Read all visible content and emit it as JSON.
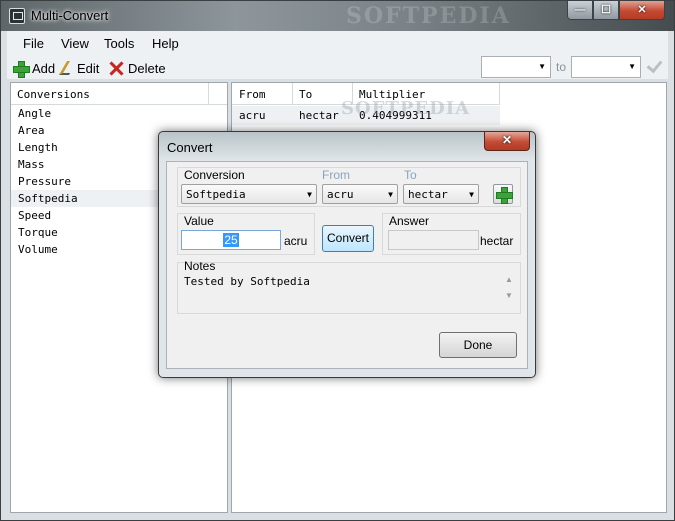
{
  "window": {
    "title": "Multi-Convert",
    "watermark": "SOFTPEDIA",
    "minimize": "—",
    "maximize": "☐",
    "close": "✕"
  },
  "menu": {
    "file": "File",
    "view": "View",
    "tools": "Tools",
    "help": "Help"
  },
  "toolbar": {
    "add_label": "Add",
    "edit_label": "Edit",
    "delete_label": "Delete",
    "to_label": "to",
    "from_value": "",
    "to_value": ""
  },
  "conversions": {
    "header": "Conversions",
    "items": [
      "Angle",
      "Area",
      "Length",
      "Mass",
      "Pressure",
      "Softpedia",
      "Speed",
      "Torque",
      "Volume"
    ],
    "selected": "Softpedia"
  },
  "table": {
    "columns": [
      "From",
      "To",
      "Multiplier"
    ],
    "rows": [
      [
        "acru",
        "hectar",
        "0.404999311"
      ]
    ]
  },
  "watermark2": "SOFTPEDIA",
  "dialog": {
    "title": "Convert",
    "close": "✕",
    "conversion_label": "Conversion",
    "from_label": "From",
    "to_label": "To",
    "conversion_value": "Softpedia",
    "from_value": "acru",
    "to_value": "hectar",
    "value_label": "Value",
    "value": "25",
    "value_unit": "acru",
    "convert_label": "Convert",
    "answer_label": "Answer",
    "answer_value": "",
    "answer_unit": "hectar",
    "notes_label": "Notes",
    "notes_text": "Tested by Softpedia",
    "done_label": "Done"
  }
}
